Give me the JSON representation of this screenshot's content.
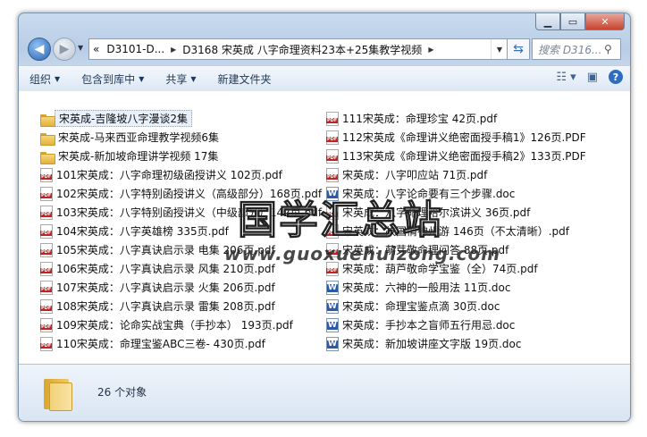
{
  "breadcrumb": {
    "overflow": "«",
    "segments": [
      "D3101-D...",
      "D3168 宋英成 八字命理资料23本+25集教学视频"
    ]
  },
  "search": {
    "placeholder": "搜索 D316..."
  },
  "toolbar": {
    "organize": "组织",
    "include_in_library": "包含到库中",
    "share": "共享",
    "new_folder": "新建文件夹"
  },
  "files_left": [
    {
      "name": "宋英成-吉隆坡八字漫谈2集",
      "type": "folder",
      "selected": true
    },
    {
      "name": "宋英成-马来西亚命理教学视频6集",
      "type": "folder"
    },
    {
      "name": "宋英成-新加坡命理讲学视频 17集",
      "type": "folder"
    },
    {
      "name": "101宋英成：八字命理初级函授讲义 102页.pdf",
      "type": "pdf"
    },
    {
      "name": "102宋英成：八字特别函授讲义（高级部分）168页.pdf",
      "type": "pdf"
    },
    {
      "name": "103宋英成：八字特别函授讲义（中级部分）142页.pdf",
      "type": "pdf"
    },
    {
      "name": "104宋英成：八字英雄榜 335页.pdf",
      "type": "pdf"
    },
    {
      "name": "105宋英成：八字真诀启示录 电集 206页.pdf",
      "type": "pdf"
    },
    {
      "name": "106宋英成：八字真诀启示录 风集 210页.pdf",
      "type": "pdf"
    },
    {
      "name": "107宋英成：八字真诀启示录 火集 206页.pdf",
      "type": "pdf"
    },
    {
      "name": "108宋英成：八字真诀启示录 雷集 208页.pdf",
      "type": "pdf"
    },
    {
      "name": "109宋英成：论命实战宝典（手抄本） 193页.pdf",
      "type": "pdf"
    },
    {
      "name": "110宋英成：命理宝鉴ABC三卷- 430页.pdf",
      "type": "pdf"
    }
  ],
  "files_right": [
    {
      "name": "111宋英成：命理珍宝  42页.pdf",
      "type": "pdf"
    },
    {
      "name": "112宋英成《命理讲义绝密面授手稿1》126页.PDF",
      "type": "pdf"
    },
    {
      "name": "113宋英成《命理讲义绝密面授手稿2》133页.PDF",
      "type": "pdf"
    },
    {
      "name": "宋英成：八字叩应站 71页.pdf",
      "type": "pdf"
    },
    {
      "name": "宋英成：八字论命要有三个步骤.doc",
      "type": "doc"
    },
    {
      "name": "宋英成：八字命理哈尔滨讲义 36页.pdf",
      "type": "pdf"
    },
    {
      "name": "宋英成：故国情神州游 146页（不太清晰）.pdf",
      "type": "pdf"
    },
    {
      "name": "宋英成：萌芽敬命理问答 88页.pdf",
      "type": "pdf"
    },
    {
      "name": "宋英成：葫芦敬命学宝鉴（全）74页.pdf",
      "type": "pdf"
    },
    {
      "name": "宋英成：六神的一般用法  11页.doc",
      "type": "doc"
    },
    {
      "name": "宋英成：命理宝鉴点滴 30页.doc",
      "type": "doc"
    },
    {
      "name": "宋英成：手抄本之盲师五行用忌.doc",
      "type": "doc"
    },
    {
      "name": "宋英成：新加坡讲座文字版 19页.doc",
      "type": "doc"
    }
  ],
  "watermark": {
    "text": "国学汇总站",
    "url": "www.guoxuehuizong.com"
  },
  "status": {
    "count_text": "26 个对象"
  }
}
